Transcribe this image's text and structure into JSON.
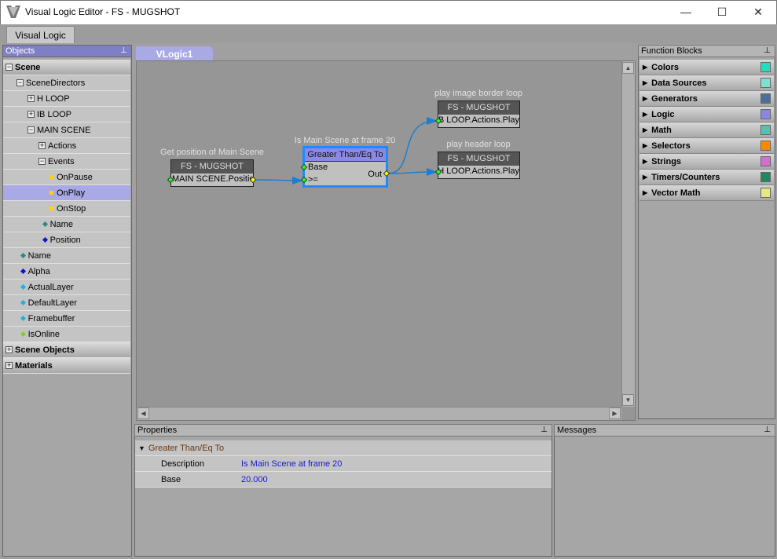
{
  "window": {
    "title": "Visual Logic Editor - FS - MUGSHOT",
    "minimize": "—",
    "maximize": "☐",
    "close": "✕"
  },
  "main_tab": "Visual Logic",
  "objects_panel": {
    "title": "Objects",
    "pin": "📌",
    "rows": [
      {
        "label": "Scene",
        "kind": "group",
        "exp": "−",
        "level": 0
      },
      {
        "label": "SceneDirectors",
        "exp": "−",
        "level": 1
      },
      {
        "label": "H LOOP",
        "exp": "+",
        "level": 2
      },
      {
        "label": "IB LOOP",
        "exp": "+",
        "level": 2
      },
      {
        "label": "MAIN SCENE",
        "exp": "−",
        "level": 2
      },
      {
        "label": "Actions",
        "exp": "+",
        "level": 3
      },
      {
        "label": "Events",
        "exp": "−",
        "level": 3
      },
      {
        "label": "OnPause",
        "icon": "event",
        "level": 4
      },
      {
        "label": "OnPlay",
        "icon": "event",
        "level": 4,
        "selected": true
      },
      {
        "label": "OnStop",
        "icon": "event",
        "level": 4
      },
      {
        "label": "Name",
        "icon": "prop",
        "color": "#2a8a80",
        "level": 3.4
      },
      {
        "label": "Position",
        "icon": "prop",
        "color": "#1010d0",
        "level": 3.4
      },
      {
        "label": "Name",
        "icon": "prop",
        "color": "#2a8a80",
        "level": 1.4
      },
      {
        "label": "Alpha",
        "icon": "prop",
        "color": "#1010d0",
        "level": 1.4
      },
      {
        "label": "ActualLayer",
        "icon": "prop",
        "color": "#20b0e0",
        "level": 1.4
      },
      {
        "label": "DefaultLayer",
        "icon": "prop",
        "color": "#20b0e0",
        "level": 1.4
      },
      {
        "label": "Framebuffer",
        "icon": "prop",
        "color": "#20b0e0",
        "level": 1.4
      },
      {
        "label": "IsOnline",
        "icon": "prop",
        "color": "#80d020",
        "level": 1.4
      },
      {
        "label": "Scene Objects",
        "kind": "group",
        "exp": "+",
        "level": 0
      },
      {
        "label": "Materials",
        "kind": "group",
        "exp": "+",
        "level": 0
      }
    ]
  },
  "canvas": {
    "tab": "VLogic1",
    "nodes": {
      "get_pos": {
        "label": "Get position of Main Scene",
        "header": "FS - MUGSHOT",
        "row": "MAIN SCENE.Position"
      },
      "gte": {
        "label": "Is Main Scene at frame 20",
        "header": "Greater Than/Eq To",
        "base": "Base",
        "gte": ">=",
        "out": "Out"
      },
      "ib": {
        "label": "play image border loop",
        "header": "FS - MUGSHOT",
        "row": "IB LOOP.Actions.Play"
      },
      "h": {
        "label": "play header loop",
        "header": "FS - MUGSHOT",
        "row": "H LOOP.Actions.Play"
      }
    }
  },
  "function_blocks": {
    "title": "Function Blocks",
    "pin": "📌",
    "items": [
      {
        "label": "Colors",
        "color": "#1ee0c0"
      },
      {
        "label": "Data Sources",
        "color": "#7ee0d0"
      },
      {
        "label": "Generators",
        "color": "#4a6e98"
      },
      {
        "label": "Logic",
        "color": "#8888e0"
      },
      {
        "label": "Math",
        "color": "#58c0b0"
      },
      {
        "label": "Selectors",
        "color": "#ff8800"
      },
      {
        "label": "Strings",
        "color": "#d070d0"
      },
      {
        "label": "Timers/Counters",
        "color": "#208860"
      },
      {
        "label": "Vector Math",
        "color": "#e8e880"
      }
    ]
  },
  "properties": {
    "title": "Properties",
    "pin": "📌",
    "section": "Greater Than/Eq To",
    "rows": [
      {
        "name": "Description",
        "value": "Is Main Scene at frame 20"
      },
      {
        "name": "Base",
        "value": "20.000"
      }
    ]
  },
  "messages": {
    "title": "Messages",
    "pin": "📌"
  }
}
